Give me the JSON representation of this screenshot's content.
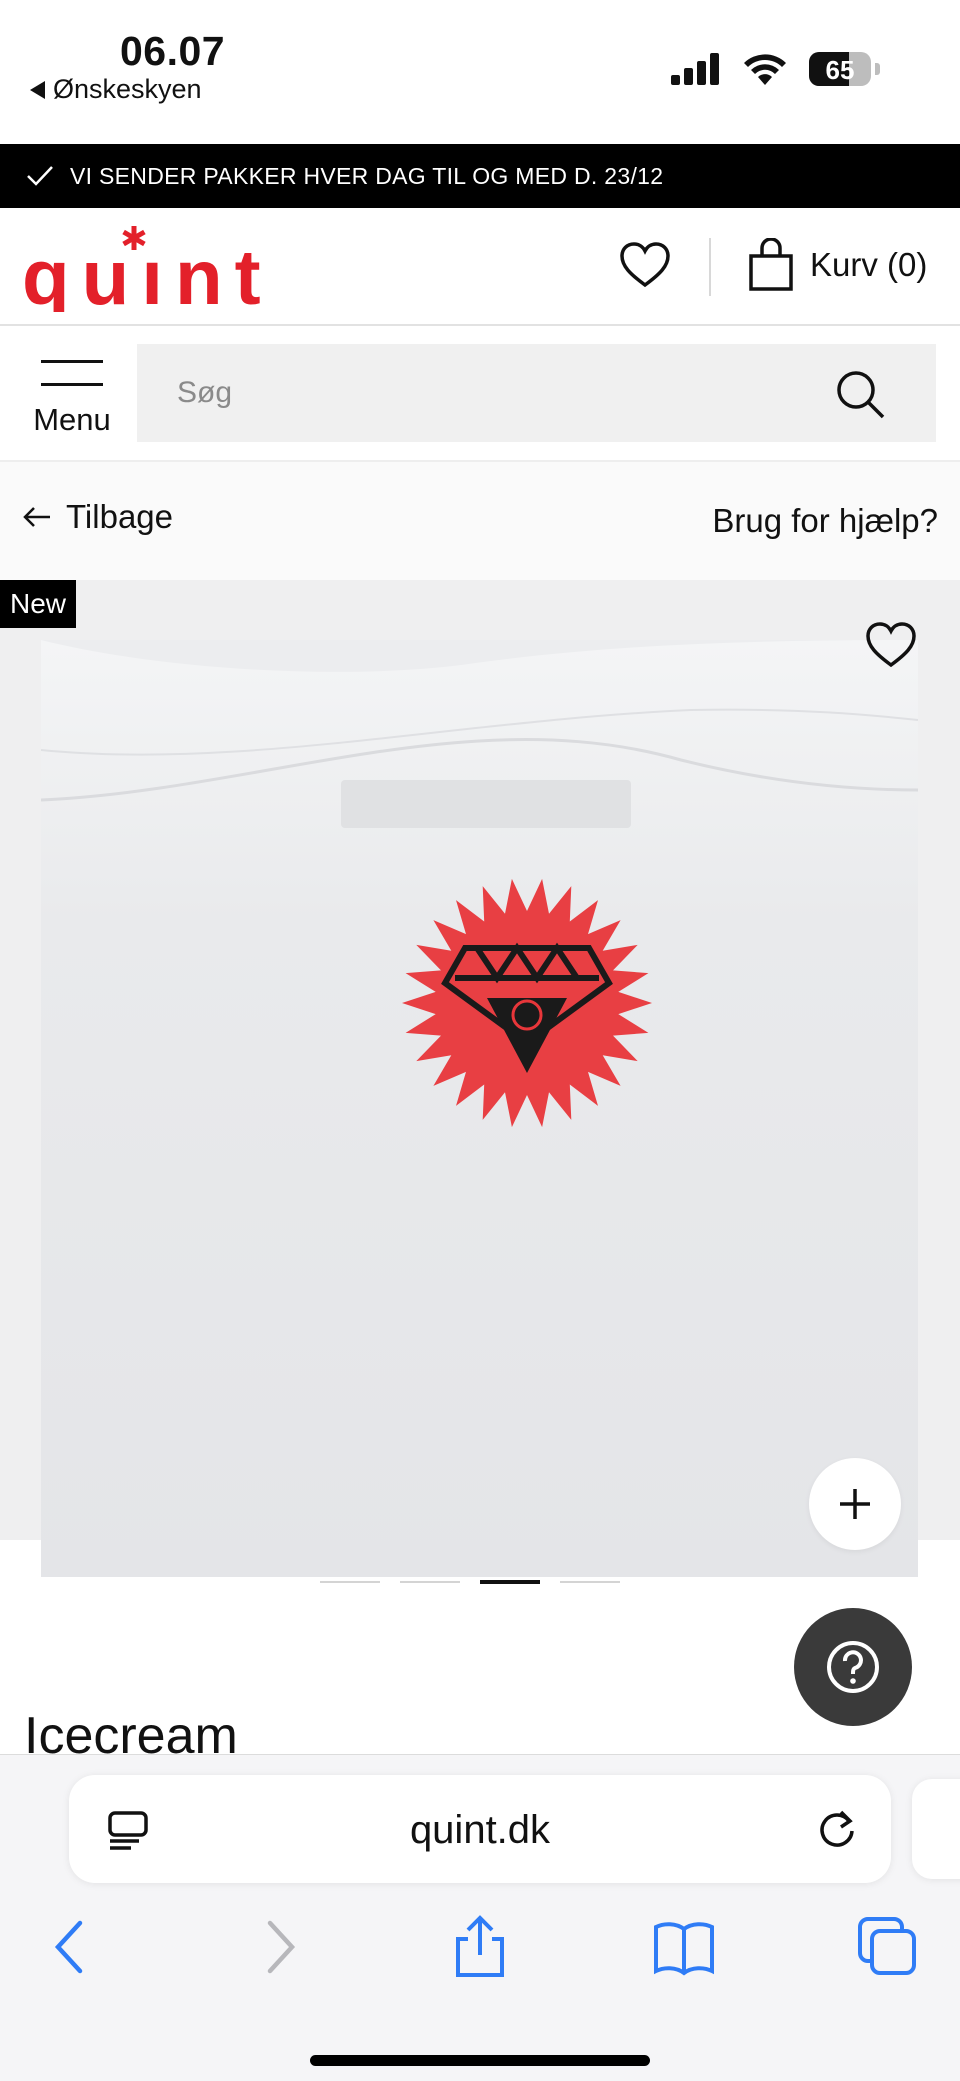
{
  "status_bar": {
    "time": "06.07",
    "back_app": "Ønskeskyen",
    "battery_level": "65",
    "battery_fraction": 0.65
  },
  "promo": {
    "text": "VI SENDER PAKKER HVER DAG TIL OG MED D. 23/12"
  },
  "header": {
    "logo_text": "quint",
    "cart_label": "Kurv (0)",
    "brand_color": "#e3202a"
  },
  "search": {
    "menu_label": "Menu",
    "placeholder": "Søg"
  },
  "nav": {
    "back_label": "Tilbage",
    "help_label": "Brug for hjælp?"
  },
  "gallery": {
    "badge": "New",
    "image_count": 4,
    "active_index": 2,
    "print_color": "#e8363a"
  },
  "product": {
    "title": "Icecream"
  },
  "browser": {
    "url": "quint.dk",
    "accent": "#2f7cf6"
  }
}
